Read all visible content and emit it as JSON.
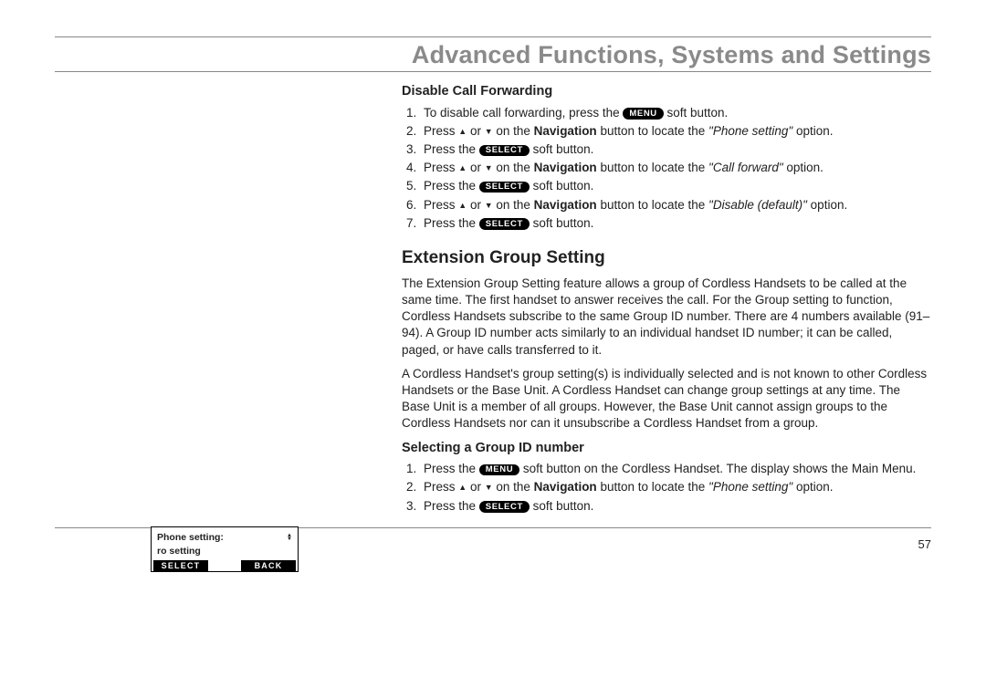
{
  "header": {
    "title": "Advanced Functions, Systems and Settings"
  },
  "buttons": {
    "menu": "MENU",
    "select": "SELECT"
  },
  "section1": {
    "heading": "Disable Call Forwarding",
    "steps": {
      "s1a": "To disable call forwarding, press the ",
      "s1b": " soft button.",
      "s2a": "Press ",
      "s2b": " or ",
      "s2c": " on the ",
      "s2nav": "Navigation",
      "s2d": " button to locate the ",
      "s2opt": "\"Phone setting\"",
      "s2e": " option.",
      "s3a": "Press the ",
      "s3b": " soft button.",
      "s4a": "Press ",
      "s4b": " or ",
      "s4c": " on the ",
      "s4nav": "Navigation",
      "s4d": " button to locate the ",
      "s4opt": "\"Call forward\"",
      "s4e": " option.",
      "s5a": "Press the ",
      "s5b": " soft button.",
      "s6a": "Press ",
      "s6b": " or ",
      "s6c": " on the ",
      "s6nav": "Navigation",
      "s6d": " button to locate the ",
      "s6opt": "\"Disable (default)\"",
      "s6e": " option.",
      "s7a": "Press the ",
      "s7b": " soft button."
    }
  },
  "section2": {
    "heading": "Extension Group Setting",
    "p1": "The Extension Group Setting feature allows a group of Cordless Handsets to be called at the same time. The first handset to answer receives the call. For the Group setting to function, Cordless Handsets subscribe to the same Group ID number. There are 4 numbers available (91–94). A Group ID number acts similarly to an individual handset ID number; it can be called, paged, or have calls transferred to it.",
    "p2": "A Cordless Handset's group setting(s) is individually selected and is not known to other Cordless Handsets or the Base Unit. A Cordless Handset can change group settings at any time. The Base Unit is a member of all groups. However, the Base Unit cannot assign groups to the Cordless Handsets nor can it unsubscribe a Cordless Handset from a group."
  },
  "section3": {
    "heading": "Selecting a Group ID number",
    "steps": {
      "s1a": "Press the ",
      "s1b": " soft button on the Cordless Handset. The display shows the Main Menu.",
      "s2a": "Press ",
      "s2b": " or ",
      "s2c": " on the ",
      "s2nav": "Navigation",
      "s2d": " button to locate the ",
      "s2opt": "\"Phone setting\"",
      "s2e": " option.",
      "s3a": "Press the ",
      "s3b": " soft button."
    }
  },
  "phone_display": {
    "line1": "Phone setting:",
    "line2": "ro setting",
    "soft_left": "SELECT",
    "soft_right": "BACK"
  },
  "page_number": "57"
}
